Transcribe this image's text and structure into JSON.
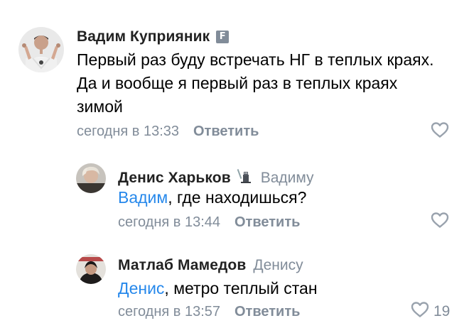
{
  "comments": [
    {
      "author": "Вадим Куприяник",
      "badge": "F",
      "text": "Первый раз буду встречать НГ в теплых краях. Да и вообще я первый раз в теплых краях зимой",
      "timestamp": "сегодня в 13:33",
      "reply_label": "Ответить",
      "like_icon": "heart-icon"
    },
    {
      "author": "Денис Харьков",
      "badge_icon": "game-character-icon",
      "reply_to": "Вадиму",
      "mention": "Вадим",
      "text": ", где находишься?",
      "timestamp": "сегодня в 13:44",
      "reply_label": "Ответить",
      "like_icon": "heart-icon"
    },
    {
      "author": "Матлаб Мамедов",
      "reply_to": "Денису",
      "mention": "Денис",
      "text": ", метро теплый стан",
      "timestamp": "сегодня в 13:57",
      "reply_label": "Ответить",
      "like_icon": "heart-icon",
      "likes": "19"
    }
  ],
  "colors": {
    "author": "#222222",
    "secondary": "#818c99",
    "link": "#2688eb",
    "text": "#000000"
  }
}
